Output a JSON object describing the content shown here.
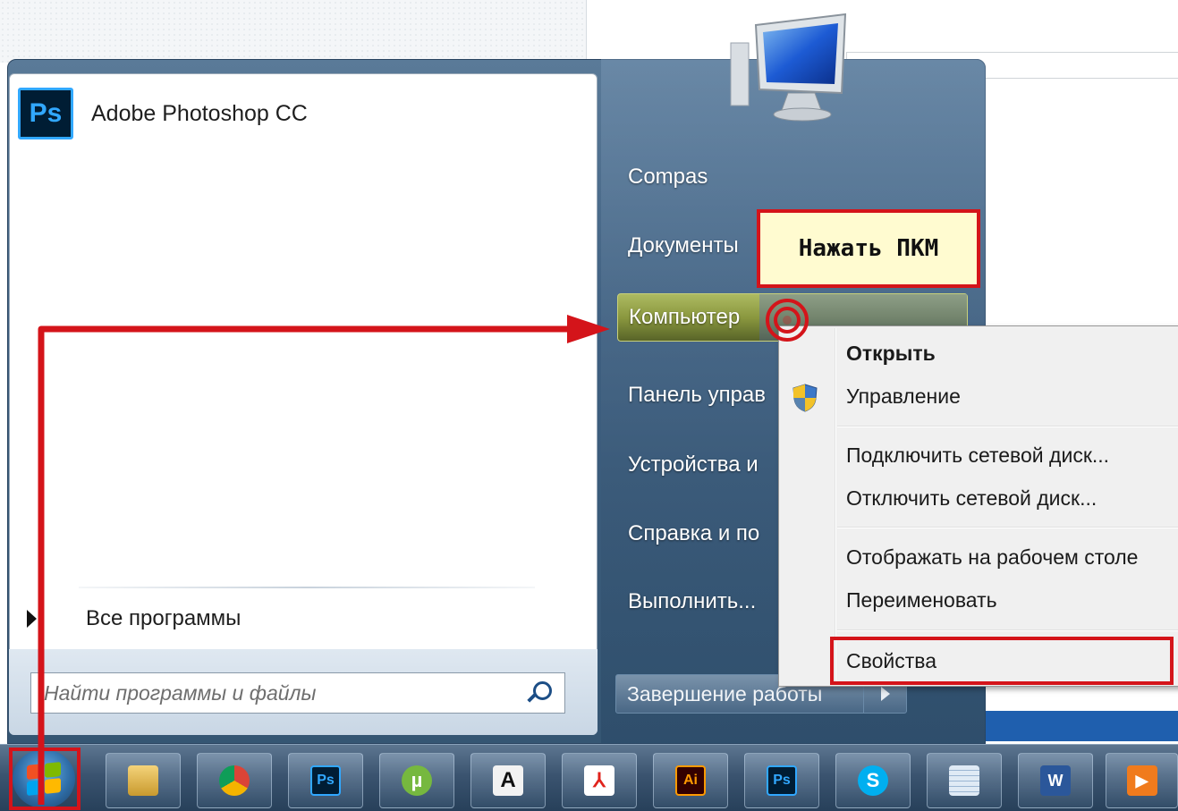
{
  "pinned_programs": [
    {
      "label": "Adobe Photoshop CC",
      "icon": "photoshop-icon",
      "icon_text": "Ps"
    }
  ],
  "all_programs_label": "Все программы",
  "search": {
    "placeholder": "Найти программы и файлы"
  },
  "right_pane": {
    "items": [
      {
        "label": "Compas"
      },
      {
        "label": "Документы"
      },
      {
        "label": "Компьютер"
      },
      {
        "label": "Панель управ"
      },
      {
        "label": "Устройства и"
      },
      {
        "label": "Справка и по"
      },
      {
        "label": "Выполнить..."
      }
    ],
    "shutdown_label": "Завершение работы"
  },
  "callout": {
    "text": "Нажать ПКМ"
  },
  "context_menu": {
    "items": [
      {
        "label": "Открыть",
        "bold": true
      },
      {
        "label": "Управление",
        "icon": "uac-shield-icon"
      },
      {
        "label": "Подключить сетевой диск..."
      },
      {
        "label": "Отключить сетевой диск..."
      },
      {
        "label": "Отображать на рабочем столе"
      },
      {
        "label": "Переименовать"
      },
      {
        "label": "Свойства"
      }
    ]
  },
  "taskbar": {
    "start_button": "windows-start-orb",
    "apps": [
      {
        "name": "explorer-icon",
        "text": ""
      },
      {
        "name": "chrome-icon",
        "text": ""
      },
      {
        "name": "photoshop-icon",
        "text": "Ps"
      },
      {
        "name": "utorrent-icon",
        "text": "µ"
      },
      {
        "name": "font-app-icon",
        "text": "A"
      },
      {
        "name": "acrobat-icon",
        "text": "⅄"
      },
      {
        "name": "illustrator-icon",
        "text": "Ai"
      },
      {
        "name": "photoshop-icon-2",
        "text": "Ps"
      },
      {
        "name": "skype-icon",
        "text": "S"
      },
      {
        "name": "notepad-icon",
        "text": ""
      },
      {
        "name": "word-icon",
        "text": "W"
      },
      {
        "name": "media-player-icon",
        "text": "▶"
      }
    ]
  },
  "colors": {
    "annotation_red": "#d4141a",
    "callout_bg": "#fffbd0",
    "taskbar_top": "#5d7690",
    "taskbar_bottom": "#27405a"
  }
}
